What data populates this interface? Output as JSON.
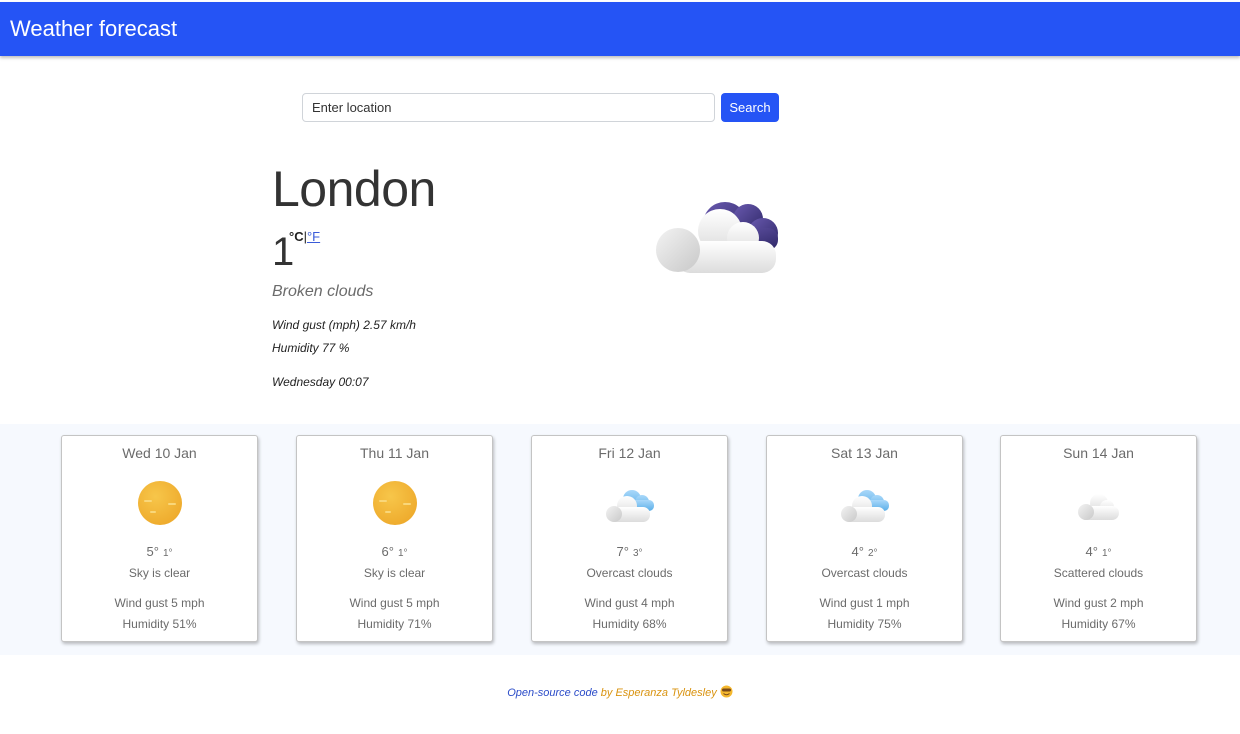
{
  "header": {
    "title": "Weather forecast"
  },
  "search": {
    "placeholder": "Enter location",
    "button_label": "Search"
  },
  "current": {
    "city": "London",
    "temperature": "1",
    "unit_celsius": "°C",
    "unit_separator": "|",
    "unit_fahrenheit": "°F",
    "description": "Broken clouds",
    "wind": "Wind gust (mph) 2.57 km/h",
    "humidity": "Humidity 77 %",
    "datetime": "Wednesday 00:07",
    "icon": "broken-clouds-night-icon"
  },
  "forecast": [
    {
      "day": "Wed 10 Jan",
      "icon": "sun-icon",
      "high": "5°",
      "low": "1°",
      "condition": "Sky is clear",
      "wind": "Wind gust 5 mph",
      "humidity": "Humidity 51%"
    },
    {
      "day": "Thu 11 Jan",
      "icon": "sun-icon",
      "high": "6°",
      "low": "1°",
      "condition": "Sky is clear",
      "wind": "Wind gust 5 mph",
      "humidity": "Humidity 71%"
    },
    {
      "day": "Fri 12 Jan",
      "icon": "overcast-clouds-icon",
      "high": "7°",
      "low": "3°",
      "condition": "Overcast clouds",
      "wind": "Wind gust 4 mph",
      "humidity": "Humidity 68%"
    },
    {
      "day": "Sat 13 Jan",
      "icon": "overcast-clouds-icon",
      "high": "4°",
      "low": "2°",
      "condition": "Overcast clouds",
      "wind": "Wind gust 1 mph",
      "humidity": "Humidity 75%"
    },
    {
      "day": "Sun 14 Jan",
      "icon": "scattered-clouds-icon",
      "high": "4°",
      "low": "1°",
      "condition": "Scattered clouds",
      "wind": "Wind gust 2 mph",
      "humidity": "Humidity 67%"
    }
  ],
  "footer": {
    "code_link": "Open-source code",
    "author_text": "by Esperanza Tyldesley",
    "emoji": "smiling-face-icon"
  },
  "colors": {
    "brand": "#2554f5",
    "link": "#2a4bc8",
    "author": "#d9930f",
    "band": "#f6f9fe"
  }
}
